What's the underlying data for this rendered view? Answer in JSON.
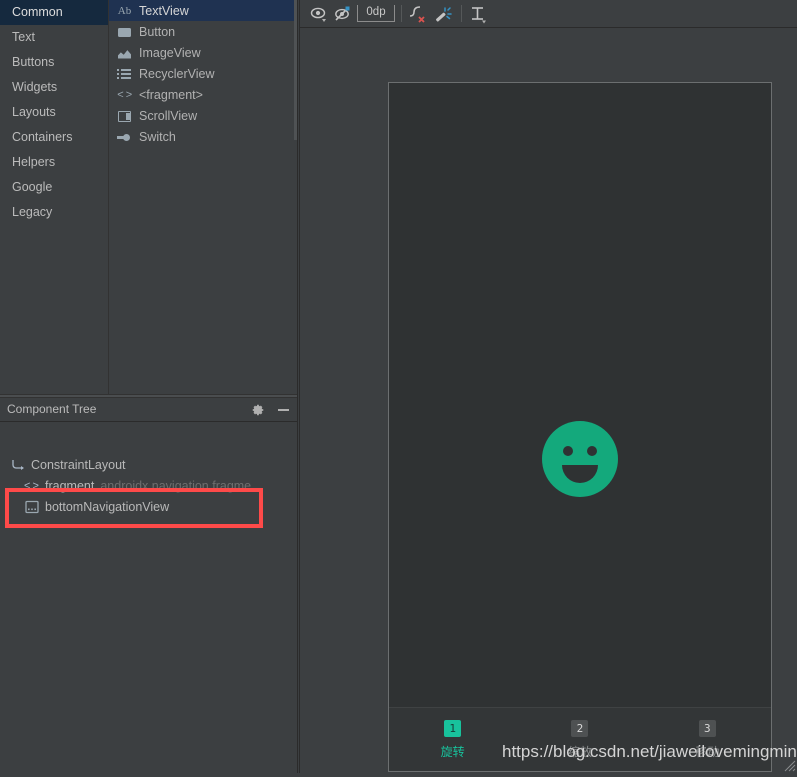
{
  "palette": {
    "categories": [
      {
        "label": "Common",
        "selected": true
      },
      {
        "label": "Text",
        "selected": false
      },
      {
        "label": "Buttons",
        "selected": false
      },
      {
        "label": "Widgets",
        "selected": false
      },
      {
        "label": "Layouts",
        "selected": false
      },
      {
        "label": "Containers",
        "selected": false
      },
      {
        "label": "Helpers",
        "selected": false
      },
      {
        "label": "Google",
        "selected": false
      },
      {
        "label": "Legacy",
        "selected": false
      }
    ],
    "items": [
      {
        "label": "TextView",
        "icon": "ab-text-icon",
        "selected": true
      },
      {
        "label": "Button",
        "icon": "button-icon",
        "selected": false
      },
      {
        "label": "ImageView",
        "icon": "image-icon",
        "selected": false
      },
      {
        "label": "RecyclerView",
        "icon": "list-icon",
        "selected": false
      },
      {
        "label": "<fragment>",
        "icon": "code-brackets-icon",
        "selected": false
      },
      {
        "label": "ScrollView",
        "icon": "scroll-icon",
        "selected": false
      },
      {
        "label": "Switch",
        "icon": "switch-icon",
        "selected": false
      }
    ],
    "ab_prefix": "Ab"
  },
  "component_tree": {
    "title": "Component Tree",
    "gear_icon": "gear-icon",
    "minimize_icon": "minimize-icon",
    "nodes": [
      {
        "label": "ConstraintLayout",
        "icon": "constraint-layout-icon",
        "detail": "",
        "highlighted": false
      },
      {
        "label": "fragment",
        "icon": "fragment-icon",
        "detail": "androidx.navigation.fragme",
        "highlighted": false
      },
      {
        "label": "bottomNavigationView",
        "icon": "bottom-navigation-icon",
        "detail": "",
        "highlighted": true
      }
    ],
    "highlight_color": "#fe4a49"
  },
  "toolbar": {
    "buttons": [
      {
        "name": "view-options-icon",
        "title": "View Options"
      },
      {
        "name": "toggle-visibility-constraints-icon",
        "title": "Show Constraints"
      },
      {
        "name": "clear-constraints-icon",
        "title": "Clear All Constraints"
      },
      {
        "name": "infer-constraints-icon",
        "title": "Infer Constraints"
      },
      {
        "name": "guideline-icon",
        "title": "Guidelines"
      }
    ],
    "default_margin": "0dp"
  },
  "canvas": {
    "wrench_icon": "wrench-icon",
    "smiley_icon": "smiley-face-icon",
    "smiley_color": "#14a97c",
    "device_background": "#2f3233",
    "bottom_nav": {
      "background": "#333637",
      "accent_color": "#18c29c",
      "items": [
        {
          "badge": "1",
          "label": "旋转",
          "active": true
        },
        {
          "badge": "2",
          "label": "缩放",
          "active": false
        },
        {
          "badge": "3",
          "label": "移动",
          "active": false
        }
      ]
    }
  },
  "watermark": {
    "text": "https://blog.csdn.net/jiaweilovemingming"
  }
}
